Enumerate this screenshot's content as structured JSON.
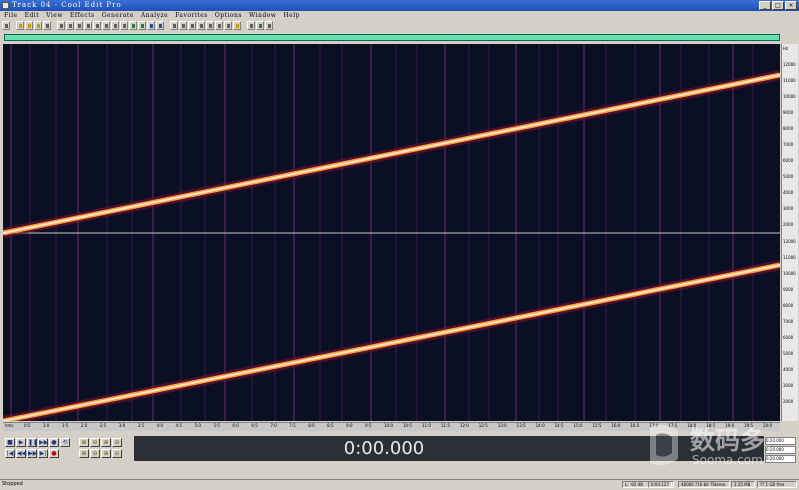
{
  "window": {
    "title": "Track 04 - Cool Edit Pro"
  },
  "window_buttons": [
    "_",
    "□",
    "×"
  ],
  "menu": [
    "File",
    "Edit",
    "View",
    "Effects",
    "Generate",
    "Analyze",
    "Favorites",
    "Options",
    "Window",
    "Help"
  ],
  "overview": {
    "visible_fraction": 1.0,
    "color": "#1aa87a"
  },
  "spectral_view": {
    "background": "#0a0f24",
    "sweep_color": "#ffe8c8",
    "channels": 2,
    "ruler_ticks": [
      "Hz",
      "12000",
      "11000",
      "10000",
      "9000",
      "8000",
      "7000",
      "6000",
      "5000",
      "4000",
      "3000",
      "2000"
    ],
    "ruler_ticks_2": [
      "12000",
      "11000",
      "10000",
      "9000",
      "8000",
      "7000",
      "6000",
      "5000",
      "4000",
      "3000",
      "2000"
    ]
  },
  "timeline": {
    "ticks": [
      "hms",
      "0:5",
      "1:0",
      "1:5",
      "2:0",
      "2:5",
      "3:0",
      "3:5",
      "4:0",
      "4:5",
      "5:0",
      "5:5",
      "6:0",
      "6:5",
      "7:0",
      "7:5",
      "8:0",
      "8:5",
      "9:0",
      "9:5",
      "10:0",
      "10:5",
      "11:0",
      "11:5",
      "12:0",
      "12:5",
      "13:0",
      "13:5",
      "14:0",
      "14:5",
      "15:0",
      "15:5",
      "16:0",
      "16:5",
      "17:0",
      "17:5",
      "18:0",
      "18:5",
      "19:0",
      "19:5",
      "20:0"
    ]
  },
  "transport": {
    "row1": [
      "■",
      "▶",
      "❚❚",
      "▶▶",
      "●",
      "⟲"
    ],
    "row2": [
      "|◀",
      "◀◀",
      "▶▶",
      "▶|",
      "●"
    ],
    "zoom1": [
      "⊕",
      "⊖",
      "⊕",
      "⊖"
    ],
    "zoom2": [
      "⊕",
      "⊖",
      "⊕",
      "⊖"
    ]
  },
  "time_display": "0:00.000",
  "selection_info": [
    "0:20.000",
    "0:20.000",
    "0:20.000"
  ],
  "status": {
    "state": "Stopped",
    "level": "L: -92 dB",
    "time": "0:04.127",
    "format": "48000 ?16-bit ?Stereo",
    "size": "2.25 MB",
    "free": "?? 1 GB free"
  },
  "watermark": {
    "cn": "数码多",
    "en": "Sooma.com"
  }
}
